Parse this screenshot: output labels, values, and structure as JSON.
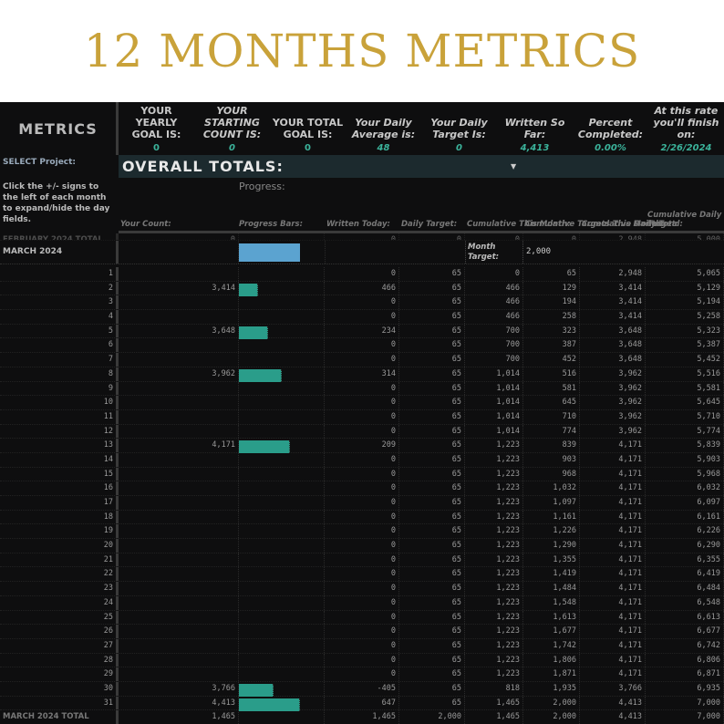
{
  "banner": "12 MONTHS METRICS",
  "header": {
    "metrics": "METRICS",
    "cols": [
      {
        "label": "YOUR YEARLY GOAL IS:",
        "value": "0",
        "italic": false
      },
      {
        "label": "YOUR STARTING COUNT IS:",
        "value": "0",
        "italic": true
      },
      {
        "label": "YOUR TOTAL GOAL IS:",
        "value": "0",
        "italic": false
      },
      {
        "label": "Your Daily Average is:",
        "value": "48",
        "italic": true
      },
      {
        "label": "Your Daily Target Is:",
        "value": "0",
        "italic": true
      },
      {
        "label": "Written So Far:",
        "value": "4,413",
        "italic": true
      },
      {
        "label": "Percent Completed:",
        "value": "0.00%",
        "italic": true
      },
      {
        "label": "At this rate you'll finish on:",
        "value": "2/26/2024",
        "italic": true
      }
    ]
  },
  "select_label": "SELECT Project:",
  "project": "OVERALL TOTALS:",
  "help": "Click the +/- signs to the left of each month to expand/hide the day fields.",
  "progress_label": "Progress:",
  "columns": [
    "Your Count:",
    "Progress Bars:",
    "Written Today:",
    "Daily Target:",
    "Cumulative This Month:",
    "Cumulative Targets This Month:",
    "Cumulative Daily Total:",
    "Cumulative Daily Target:"
  ],
  "prev_total": {
    "label": "FEBRUARY 2024 TOTAL",
    "values": [
      "0",
      "",
      "0",
      "0",
      "0",
      "0",
      "2,948",
      "5,000"
    ]
  },
  "month": {
    "label": "MARCH 2024",
    "target_label": "Month Target:",
    "target": "2,000",
    "progress": 0.7325,
    "bar_color": "#5ba3d0"
  },
  "bar_color": "#2a9d8a",
  "days": [
    [
      "1",
      "",
      "0",
      "65",
      "0",
      "65",
      "2,948",
      "5,065"
    ],
    [
      "2",
      "3,414",
      "466",
      "65",
      "466",
      "129",
      "3,414",
      "5,129"
    ],
    [
      "3",
      "",
      "0",
      "65",
      "466",
      "194",
      "3,414",
      "5,194"
    ],
    [
      "4",
      "",
      "0",
      "65",
      "466",
      "258",
      "3,414",
      "5,258"
    ],
    [
      "5",
      "3,648",
      "234",
      "65",
      "700",
      "323",
      "3,648",
      "5,323"
    ],
    [
      "6",
      "",
      "0",
      "65",
      "700",
      "387",
      "3,648",
      "5,387"
    ],
    [
      "7",
      "",
      "0",
      "65",
      "700",
      "452",
      "3,648",
      "5,452"
    ],
    [
      "8",
      "3,962",
      "314",
      "65",
      "1,014",
      "516",
      "3,962",
      "5,516"
    ],
    [
      "9",
      "",
      "0",
      "65",
      "1,014",
      "581",
      "3,962",
      "5,581"
    ],
    [
      "10",
      "",
      "0",
      "65",
      "1,014",
      "645",
      "3,962",
      "5,645"
    ],
    [
      "11",
      "",
      "0",
      "65",
      "1,014",
      "710",
      "3,962",
      "5,710"
    ],
    [
      "12",
      "",
      "0",
      "65",
      "1,014",
      "774",
      "3,962",
      "5,774"
    ],
    [
      "13",
      "4,171",
      "209",
      "65",
      "1,223",
      "839",
      "4,171",
      "5,839"
    ],
    [
      "14",
      "",
      "0",
      "65",
      "1,223",
      "903",
      "4,171",
      "5,903"
    ],
    [
      "15",
      "",
      "0",
      "65",
      "1,223",
      "968",
      "4,171",
      "5,968"
    ],
    [
      "16",
      "",
      "0",
      "65",
      "1,223",
      "1,032",
      "4,171",
      "6,032"
    ],
    [
      "17",
      "",
      "0",
      "65",
      "1,223",
      "1,097",
      "4,171",
      "6,097"
    ],
    [
      "18",
      "",
      "0",
      "65",
      "1,223",
      "1,161",
      "4,171",
      "6,161"
    ],
    [
      "19",
      "",
      "0",
      "65",
      "1,223",
      "1,226",
      "4,171",
      "6,226"
    ],
    [
      "20",
      "",
      "0",
      "65",
      "1,223",
      "1,290",
      "4,171",
      "6,290"
    ],
    [
      "21",
      "",
      "0",
      "65",
      "1,223",
      "1,355",
      "4,171",
      "6,355"
    ],
    [
      "22",
      "",
      "0",
      "65",
      "1,223",
      "1,419",
      "4,171",
      "6,419"
    ],
    [
      "23",
      "",
      "0",
      "65",
      "1,223",
      "1,484",
      "4,171",
      "6,484"
    ],
    [
      "24",
      "",
      "0",
      "65",
      "1,223",
      "1,548",
      "4,171",
      "6,548"
    ],
    [
      "25",
      "",
      "0",
      "65",
      "1,223",
      "1,613",
      "4,171",
      "6,613"
    ],
    [
      "26",
      "",
      "0",
      "65",
      "1,223",
      "1,677",
      "4,171",
      "6,677"
    ],
    [
      "27",
      "",
      "0",
      "65",
      "1,223",
      "1,742",
      "4,171",
      "6,742"
    ],
    [
      "28",
      "",
      "0",
      "65",
      "1,223",
      "1,806",
      "4,171",
      "6,806"
    ],
    [
      "29",
      "",
      "0",
      "65",
      "1,223",
      "1,871",
      "4,171",
      "6,871"
    ],
    [
      "30",
      "3,766",
      "-405",
      "65",
      "818",
      "1,935",
      "3,766",
      "6,935"
    ],
    [
      "31",
      "4,413",
      "647",
      "65",
      "1,465",
      "2,000",
      "4,413",
      "7,000"
    ]
  ],
  "day_progress": [
    0,
    0.233,
    0,
    0,
    0.35,
    0,
    0,
    0.507,
    0,
    0,
    0,
    0,
    0.6115,
    0,
    0,
    0,
    0,
    0,
    0,
    0,
    0,
    0,
    0,
    0,
    0,
    0,
    0,
    0,
    0,
    0.409,
    0.7325
  ],
  "total": {
    "label": "MARCH 2024 TOTAL",
    "values": [
      "1,465",
      "",
      "1,465",
      "2,000",
      "1,465",
      "2,000",
      "4,413",
      "7,000"
    ]
  }
}
